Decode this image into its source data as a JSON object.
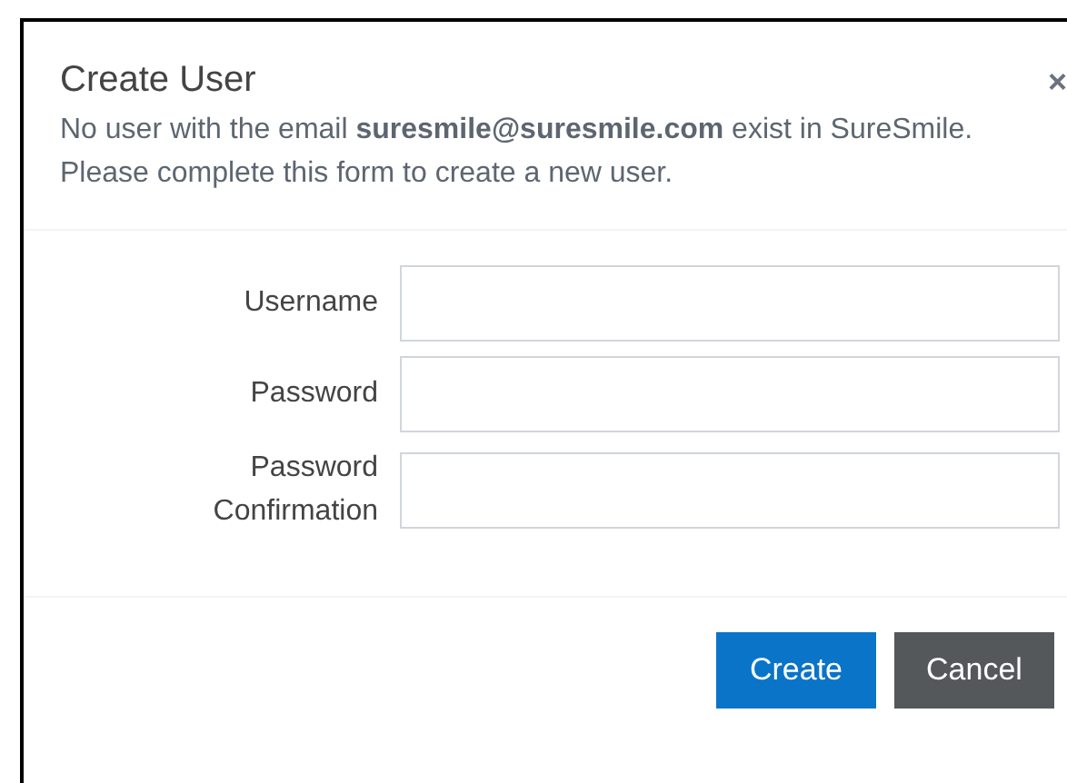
{
  "dialog": {
    "title": "Create User",
    "close": "×",
    "message": [
      "No user with the email **suresmile@suresmile.com** exist in SureSmile.",
      "Please complete this form to create a new user."
    ],
    "fields": [
      {
        "label": "Username"
      },
      {
        "label": "Password"
      },
      {
        "label": "Password Confirmation"
      }
    ],
    "buttons": [
      {
        "label": "Create",
        "kind": "primary"
      },
      {
        "label": "Cancel",
        "kind": "secondary"
      }
    ]
  }
}
